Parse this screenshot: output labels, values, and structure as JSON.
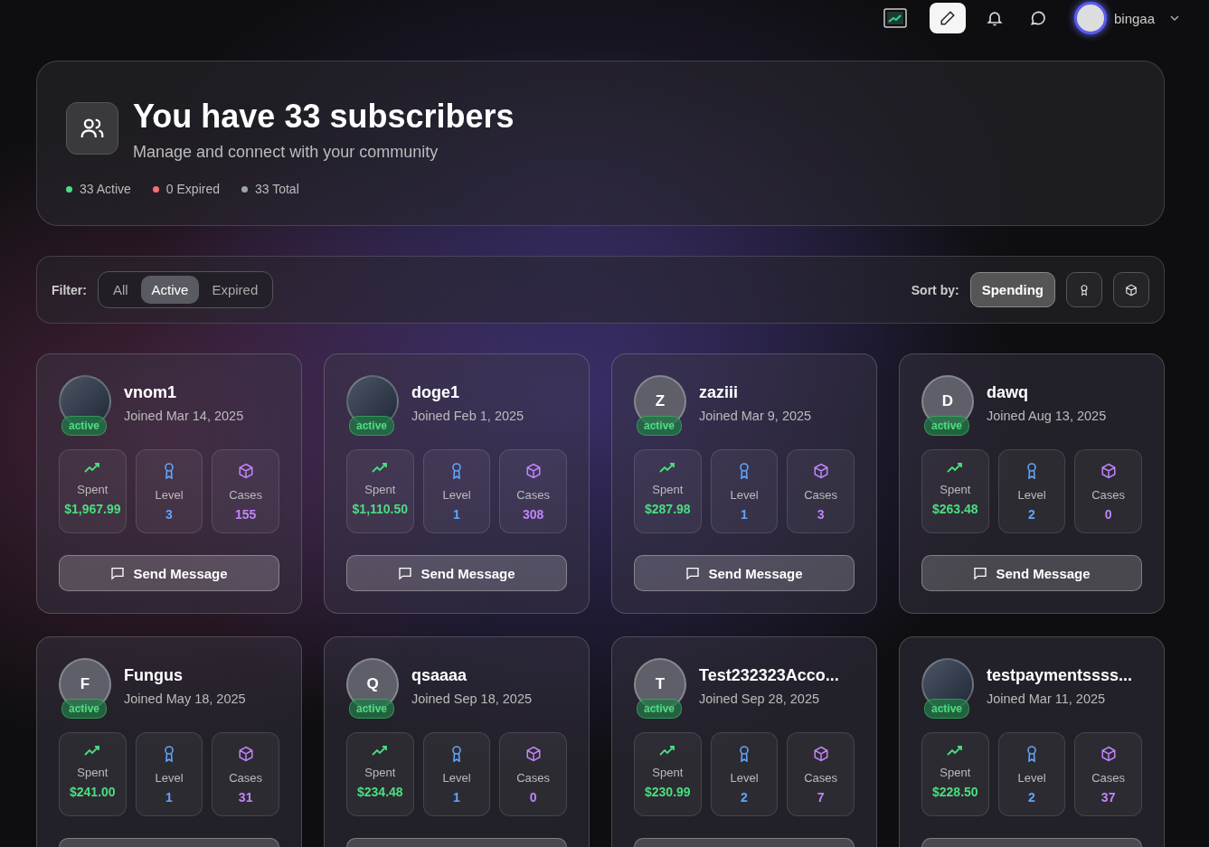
{
  "topbar": {
    "user": {
      "name": "bingaa"
    }
  },
  "header": {
    "title": "You have 33 subscribers",
    "subtitle": "Manage and connect with your community",
    "stats": [
      {
        "label": "33 Active",
        "color": "#4ade80"
      },
      {
        "label": "0 Expired",
        "color": "#f87171"
      },
      {
        "label": "33 Total",
        "color": "#9ca3af"
      }
    ]
  },
  "filter": {
    "label": "Filter:",
    "options": [
      {
        "label": "All",
        "selected": false
      },
      {
        "label": "Active",
        "selected": true
      },
      {
        "label": "Expired",
        "selected": false
      }
    ]
  },
  "sort": {
    "label": "Sort by:",
    "options": [
      {
        "kind": "spending",
        "label": "Spending",
        "selected": true
      },
      {
        "kind": "level",
        "selected": false
      },
      {
        "kind": "cases",
        "selected": false
      }
    ]
  },
  "subscribers": [
    {
      "name": "vnom1",
      "joined": "Joined Mar 14, 2025",
      "avatar": {
        "kind": "image"
      },
      "status": "active",
      "stats": [
        {
          "kind": "spent",
          "label": "Spent",
          "value": "$1,967.99"
        },
        {
          "kind": "level",
          "label": "Level",
          "value": "3"
        },
        {
          "kind": "cases",
          "label": "Cases",
          "value": "155"
        }
      ],
      "button": "Send Message"
    },
    {
      "name": "doge1",
      "joined": "Joined Feb 1, 2025",
      "avatar": {
        "kind": "image"
      },
      "status": "active",
      "stats": [
        {
          "kind": "spent",
          "label": "Spent",
          "value": "$1,110.50"
        },
        {
          "kind": "level",
          "label": "Level",
          "value": "1"
        },
        {
          "kind": "cases",
          "label": "Cases",
          "value": "308"
        }
      ],
      "button": "Send Message"
    },
    {
      "name": "zaziii",
      "joined": "Joined Mar 9, 2025",
      "avatar": {
        "kind": "initial",
        "text": "Z"
      },
      "status": "active",
      "stats": [
        {
          "kind": "spent",
          "label": "Spent",
          "value": "$287.98"
        },
        {
          "kind": "level",
          "label": "Level",
          "value": "1"
        },
        {
          "kind": "cases",
          "label": "Cases",
          "value": "3"
        }
      ],
      "button": "Send Message"
    },
    {
      "name": "dawq",
      "joined": "Joined Aug 13, 2025",
      "avatar": {
        "kind": "initial",
        "text": "D"
      },
      "status": "active",
      "stats": [
        {
          "kind": "spent",
          "label": "Spent",
          "value": "$263.48"
        },
        {
          "kind": "level",
          "label": "Level",
          "value": "2"
        },
        {
          "kind": "cases",
          "label": "Cases",
          "value": "0"
        }
      ],
      "button": "Send Message"
    },
    {
      "name": "Fungus",
      "joined": "Joined May 18, 2025",
      "avatar": {
        "kind": "initial",
        "text": "F"
      },
      "status": "active",
      "stats": [
        {
          "kind": "spent",
          "label": "Spent",
          "value": "$241.00"
        },
        {
          "kind": "level",
          "label": "Level",
          "value": "1"
        },
        {
          "kind": "cases",
          "label": "Cases",
          "value": "31"
        }
      ]
    },
    {
      "name": "qsaaaa",
      "joined": "Joined Sep 18, 2025",
      "avatar": {
        "kind": "initial",
        "text": "Q"
      },
      "status": "active",
      "stats": [
        {
          "kind": "spent",
          "label": "Spent",
          "value": "$234.48"
        },
        {
          "kind": "level",
          "label": "Level",
          "value": "1"
        },
        {
          "kind": "cases",
          "label": "Cases",
          "value": "0"
        }
      ]
    },
    {
      "name": "Test232323Acco...",
      "joined": "Joined Sep 28, 2025",
      "avatar": {
        "kind": "initial",
        "text": "T"
      },
      "status": "active",
      "stats": [
        {
          "kind": "spent",
          "label": "Spent",
          "value": "$230.99"
        },
        {
          "kind": "level",
          "label": "Level",
          "value": "2"
        },
        {
          "kind": "cases",
          "label": "Cases",
          "value": "7"
        }
      ]
    },
    {
      "name": "testpaymentssss...",
      "joined": "Joined Mar 11, 2025",
      "avatar": {
        "kind": "image"
      },
      "status": "active",
      "stats": [
        {
          "kind": "spent",
          "label": "Spent",
          "value": "$228.50"
        },
        {
          "kind": "level",
          "label": "Level",
          "value": "2"
        },
        {
          "kind": "cases",
          "label": "Cases",
          "value": "37"
        }
      ]
    }
  ]
}
